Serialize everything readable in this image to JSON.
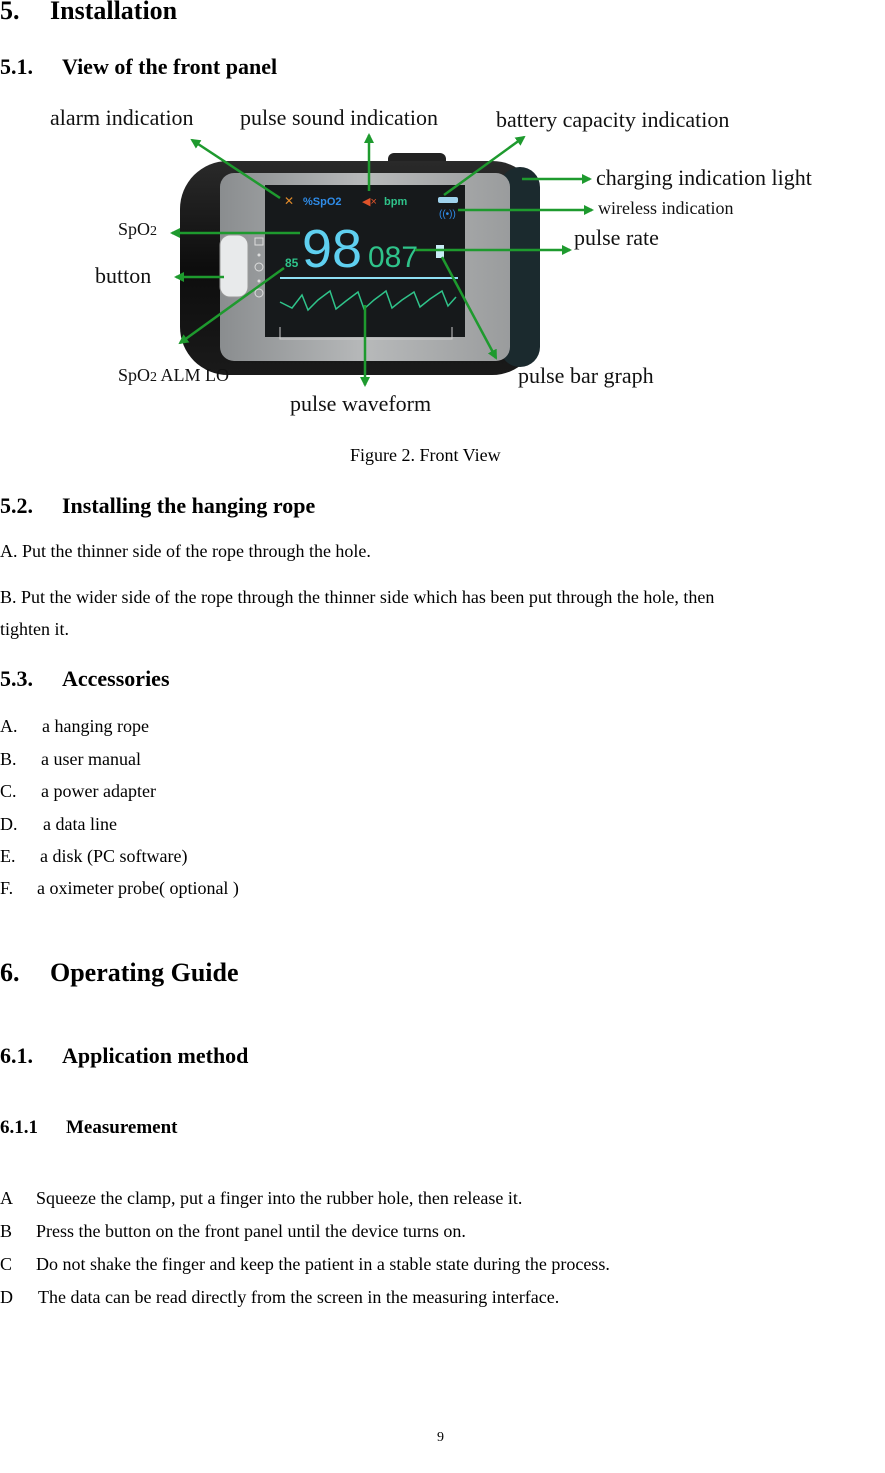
{
  "sections": {
    "s5": {
      "num": "5.",
      "title": "Installation"
    },
    "s51": {
      "num": "5.1.",
      "title": "View of the front panel"
    },
    "s52": {
      "num": "5.2.",
      "title": "Installing the hanging rope"
    },
    "s53": {
      "num": "5.3.",
      "title": "Accessories"
    },
    "s6": {
      "num": "6.",
      "title": "Operating Guide"
    },
    "s61": {
      "num": "6.1.",
      "title": "Application method"
    },
    "s611": {
      "num": "6.1.1",
      "title": "Measurement"
    }
  },
  "figure": {
    "caption": "Figure 2. Front View",
    "labels": {
      "alarm": "alarm indication",
      "pulse_sound": "pulse sound indication",
      "battery": "battery capacity indication",
      "charging": "charging indication light",
      "wireless": "wireless indication",
      "pulse_rate": "pulse rate",
      "spo2_main": "SpO",
      "spo2_sub": "2",
      "button": "button",
      "spo2_alm_main": "SpO",
      "spo2_alm_sub": "2",
      "spo2_alm_rest": " ALM LO",
      "pulse_bar": "pulse bar graph",
      "pulse_wave": "pulse waveform"
    },
    "screen": {
      "spo2_unit": "%SpO2",
      "bpm_unit": "bpm",
      "spo2_value": "98",
      "pulse_value": "087",
      "alarm_low": "85"
    },
    "colors": {
      "arrow": "#1e9a2e",
      "cyan": "#5fd0f0",
      "green": "#2fc38a",
      "orange": "#e0532a",
      "blue": "#2f8ce8"
    }
  },
  "rope_steps": [
    "A. Put the thinner side of the rope through the hole.",
    "B. Put the wider side of the rope through the thinner side which has been put through the hole, then",
    "tighten it."
  ],
  "accessories": [
    {
      "letter": "A.",
      "text": "a hanging rope"
    },
    {
      "letter": "B.",
      "text": "a user manual"
    },
    {
      "letter": "C.",
      "text": "a power adapter"
    },
    {
      "letter": "D.",
      "text": "a data line"
    },
    {
      "letter": "E.",
      "text": "a disk (PC software)"
    },
    {
      "letter": "F.",
      "text": "a oximeter probe( optional )"
    }
  ],
  "measurement_steps": [
    {
      "letter": "A",
      "text": "Squeeze the clamp, put a finger into the rubber hole, then release it."
    },
    {
      "letter": "B",
      "text": "Press the button on the front panel until the device turns on."
    },
    {
      "letter": "C",
      "text": "Do not shake the finger and keep the patient in a stable state during the process."
    },
    {
      "letter": "D",
      "text": "The data can be read directly from the screen in the measuring interface."
    }
  ],
  "page_number": "9"
}
